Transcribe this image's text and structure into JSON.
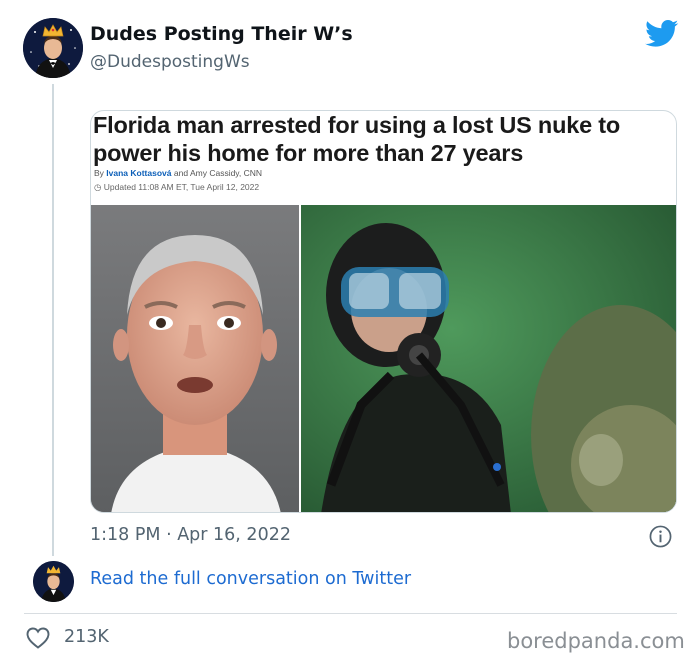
{
  "tweet": {
    "display_name": "Dudes Posting Their W’s",
    "handle": "@DudespostingWs",
    "timestamp": "1:18 PM · Apr 16, 2022",
    "read_link": "Read the full conversation on Twitter",
    "like_count": "213K"
  },
  "article": {
    "headline": "Florida man arrested for using a lost US nuke to power his home for more than 27 years",
    "byline_prefix": "By",
    "author_1": "Ivana Kottasová",
    "byline_join": "and",
    "author_2": "Amy Cassidy, CNN",
    "updated": "Updated 11:08 AM ET, Tue April 12, 2022"
  },
  "watermark": "boredpanda.com",
  "colors": {
    "twitter_blue": "#1d9bf0",
    "link_blue": "#1d6bd1",
    "secondary_text": "#536471",
    "byline_link": "#0c5fb8"
  },
  "icons": {
    "brand": "twitter-bird-icon",
    "info": "info-icon",
    "like": "heart-icon"
  }
}
